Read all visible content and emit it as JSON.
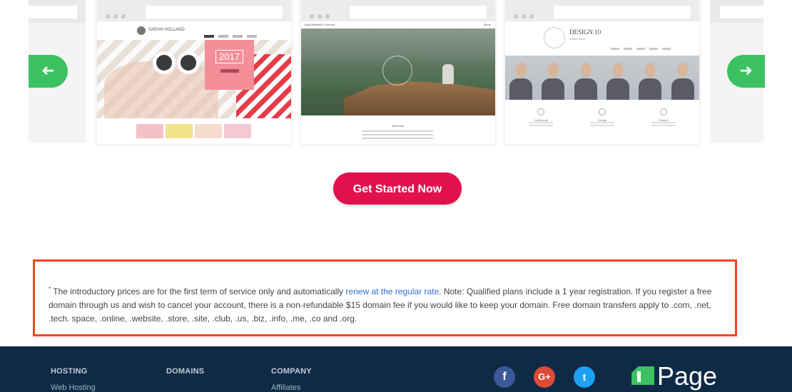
{
  "carousel": {
    "templates": [
      {
        "site_name": "SARAH HOLLAND",
        "year_badge": "2017",
        "thumb_colors": [
          "#f2c2c8",
          "#f1e38a",
          "#f6dccd",
          "#f3c9d4"
        ]
      },
      {
        "site_name": "Lady Arklebell's Journey",
        "menu_label": "Menu",
        "section_title": "About Me"
      },
      {
        "site_name": "DESIGN 10",
        "site_tagline": "Adobe Muse",
        "features": [
          "Collaborate",
          "Design",
          "Passion"
        ]
      }
    ],
    "prev_icon": "arrow-left-icon",
    "next_icon": "arrow-right-icon",
    "prev_glyph": "➜",
    "next_glyph": "➜"
  },
  "cta": {
    "label": "Get Started Now",
    "color": "#e1114e"
  },
  "disclaimer": {
    "asterisk": "*",
    "text_before": " The introductory prices are for the first term of service only and automatically ",
    "link_text": "renew at the regular rate",
    "text_after": ". Note: Qualified plans include a 1 year registration. If you register a free domain through us and wish to cancel your account, there is a non-refundable $15 domain fee if you would like to keep your domain. Free domain transfers apply to .com, .net, .tech. space, .online, .website, .store, .site, .club, .us, .biz, .info, .me, .co and .org.",
    "border_color": "#f0461f"
  },
  "footer": {
    "columns": [
      {
        "heading": "HOSTING",
        "first_link": "Web Hosting"
      },
      {
        "heading": "DOMAINS",
        "first_link": ""
      },
      {
        "heading": "COMPANY",
        "first_link": "Affiliates"
      }
    ],
    "social": [
      {
        "name": "facebook-icon",
        "glyph": "f"
      },
      {
        "name": "google-plus-icon",
        "glyph": "G+"
      },
      {
        "name": "twitter-icon",
        "glyph": "t"
      }
    ],
    "logo_text": "Page",
    "background": "#0f2a45"
  }
}
